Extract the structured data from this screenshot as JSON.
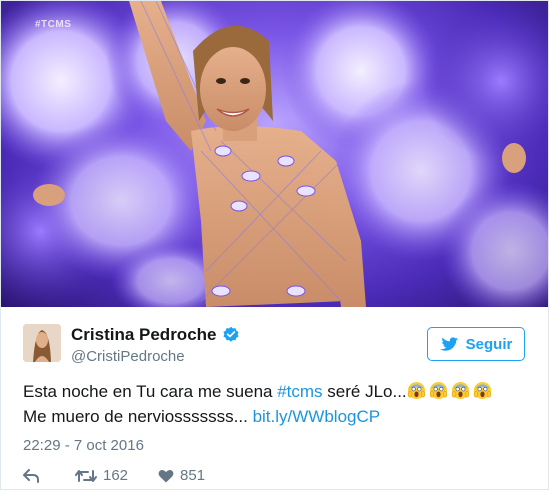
{
  "media": {
    "watermark": "#TCMS"
  },
  "author": {
    "display_name": "Cristina Pedroche",
    "handle": "@CristiPedroche",
    "verified": true
  },
  "follow_button": {
    "label": "Seguir"
  },
  "tweet": {
    "line1_before": "Esta noche en Tu cara me suena ",
    "hashtag": "#tcms",
    "line1_after": " seré JLo...",
    "emoji_name": "face-screaming-in-fear",
    "emoji_count": 4,
    "line2_before": "Me muero de nerviosssssss... ",
    "link": "bit.ly/WWblogCP"
  },
  "timestamp": "22:29 - 7 oct 2016",
  "actions": {
    "retweets": "162",
    "likes": "851"
  },
  "colors": {
    "link": "#1b95e0",
    "accent": "#1da1f2",
    "muted": "#657786",
    "media_purple": "#7a55e6"
  }
}
